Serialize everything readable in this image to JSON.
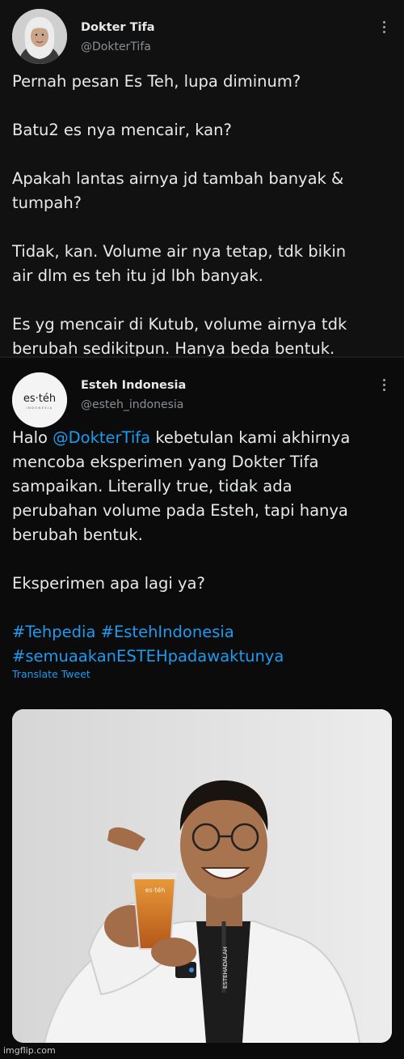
{
  "tweet1": {
    "author_name": "Dokter Tifa",
    "author_handle": "@DokterTifa",
    "lines": [
      "Pernah pesan Es Teh,  lupa diminum?",
      "",
      "Batu2 es nya  mencair, kan?",
      "",
      "Apakah lantas airnya jd tambah  banyak &",
      "tumpah?",
      "",
      "Tidak, kan. Volume air nya tetap,  tdk bikin",
      "air dlm  es teh itu jd lbh banyak.",
      "",
      "Es yg mencair di Kutub, volume airnya  tdk",
      "berubah sedikitpun. Hanya beda bentuk."
    ]
  },
  "tweet2": {
    "author_name": "Esteh Indonesia",
    "author_handle": "@esteh_indonesia",
    "avatar_logo": "es·téh",
    "avatar_sub": "INDONESIA",
    "greeting": "Halo",
    "mention": "@DokterTifa",
    "line1_rest": " kebetulan kami akhirnya",
    "lines": [
      "mencoba eksperimen yang Dokter Tifa",
      "sampaikan. Literally true, tidak ada",
      "perubahan volume pada Esteh, tapi hanya",
      "berubah bentuk.",
      "",
      "Eksperimen apa lagi ya?",
      ""
    ],
    "hashtags_line1": "#Tehpedia #EstehIndonesia",
    "hashtags_line2": "#semuaakanESTEHpadawaktunya",
    "translate_label": "Translate Tweet",
    "cup_label": "es·téh",
    "lanyard_text": "ESTEHADALAH"
  },
  "colors": {
    "link": "#1d9bf0",
    "text": "#e7e9ea",
    "secondary": "#8b8f93",
    "background": "#111111"
  },
  "icons": {
    "more": "more-vertical-icon"
  },
  "watermark": "imgflip.com"
}
